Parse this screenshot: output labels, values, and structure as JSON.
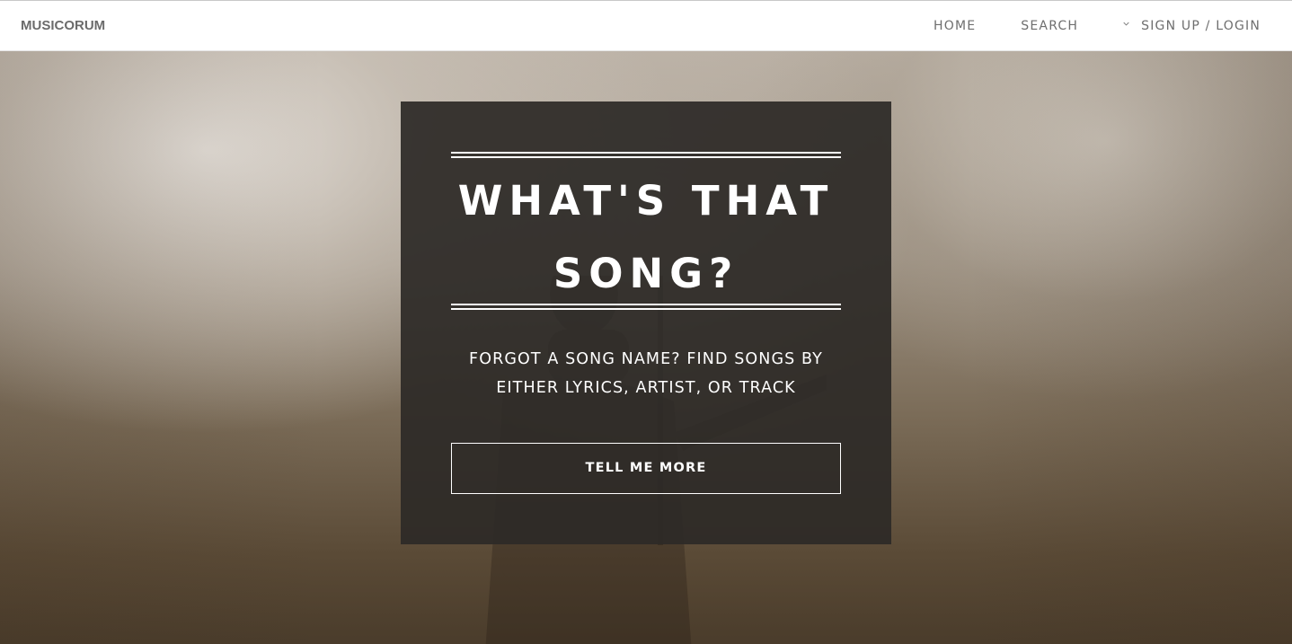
{
  "navbar": {
    "brand": "MUSICORUM",
    "links": {
      "home": "HOME",
      "search": "SEARCH",
      "signup_login": "SIGN UP / LOGIN"
    }
  },
  "hero": {
    "headline": "WHAT'S THAT SONG?",
    "subtext": "FORGOT A SONG NAME? FIND SONGS BY EITHER LYRICS, ARTIST, OR TRACK",
    "cta_label": "TELL ME MORE"
  },
  "icons": {
    "signup_chevron": "chevron-down-icon"
  },
  "colors": {
    "nav_text": "#6e6e6e",
    "card_bg": "#2d2a27",
    "card_text": "#ffffff"
  }
}
